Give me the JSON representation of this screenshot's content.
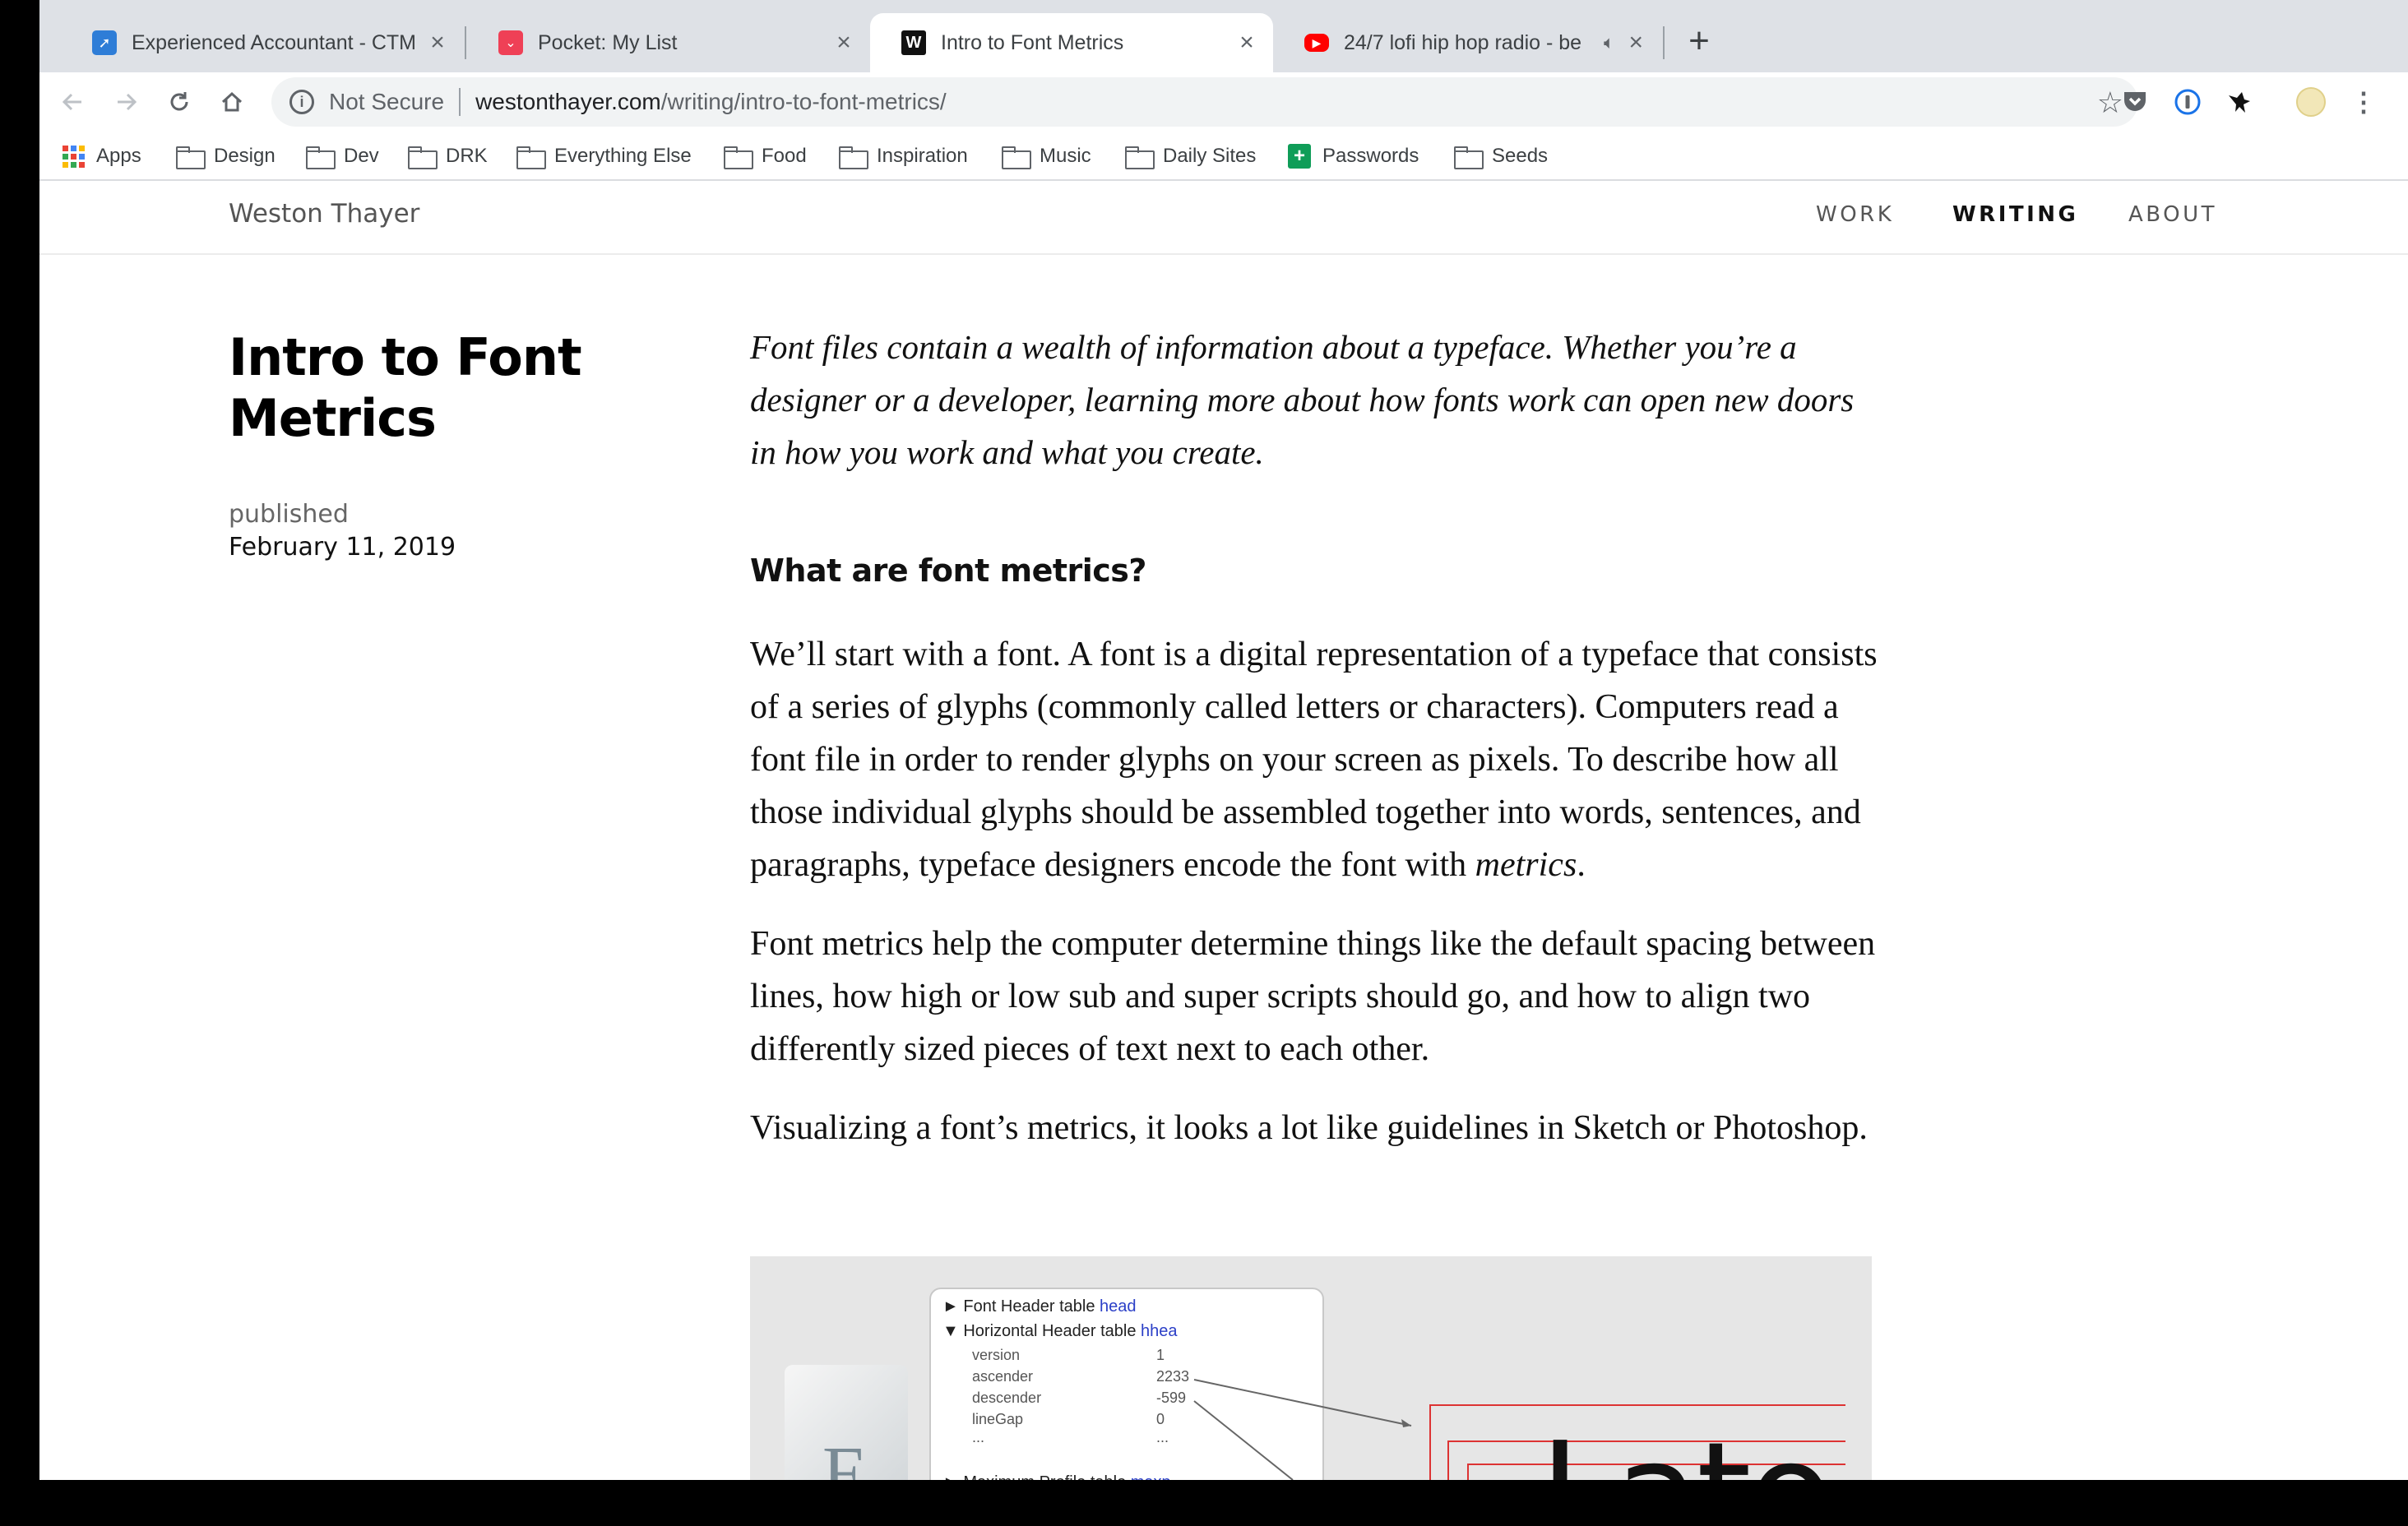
{
  "tabs": [
    {
      "title": "Experienced Accountant - CTM",
      "icon": "ctm-favicon",
      "color": "#2e7dd7"
    },
    {
      "title": "Pocket: My List",
      "icon": "pocket-favicon",
      "color": "#ef4056"
    },
    {
      "title": "Intro to Font Metrics",
      "icon": "w-favicon",
      "color": "#111111"
    },
    {
      "title": "24/7 lofi hip hop radio - be",
      "icon": "youtube-favicon",
      "color": "#ff0000"
    }
  ],
  "address": {
    "security": "Not Secure",
    "host": "westonthayer.com",
    "path": "/writing/intro-to-font-metrics/"
  },
  "bookmarks": [
    "Apps",
    "Design",
    "Dev",
    "DRK",
    "Everything Else",
    "Food",
    "Inspiration",
    "Music",
    "Daily Sites",
    "Passwords",
    "Seeds"
  ],
  "site": {
    "name": "Weston Thayer",
    "nav": [
      "WORK",
      "WRITING",
      "ABOUT"
    ],
    "active_nav": "WRITING"
  },
  "post": {
    "title": "Intro to Font Metrics",
    "published_label": "published",
    "date": "February 11, 2019",
    "lede": "Font files contain a wealth of information about a typeface. Whether you’re a designer or a developer, learning more about how fonts work can open new doors in how you work and what you create.",
    "heading": "What are font metrics?",
    "p1_before": "We’ll start with a font. A font is a digital representation of a typeface that consists of a series of glyphs (commonly called letters or characters). Computers read a font file in order to render glyphs on your screen as pixels. To describe how all those individual glyphs should be assembled together into words, sentences, and paragraphs, typeface designers encode the font with ",
    "p1_em": "metrics",
    "p1_after": ".",
    "p2": "Font metrics help the computer determine things like the default spacing between lines, how high or low sub and super scripts should go, and how to align two differently sized pieces of text next to each other.",
    "p3": "Visualizing a font’s metrics, it looks a lot like guidelines in Sketch or Photoshop."
  },
  "figure": {
    "rows": [
      {
        "label": "► Font Header table ",
        "tag": "head"
      },
      {
        "label": "▼ Horizontal Header table ",
        "tag": "hhea"
      }
    ],
    "fields": [
      {
        "k": "version",
        "v": "1"
      },
      {
        "k": "ascender",
        "v": "2233"
      },
      {
        "k": "descender",
        "v": "-599"
      },
      {
        "k": "lineGap",
        "v": "0"
      },
      {
        "k": "...",
        "v": "..."
      }
    ],
    "next_row": {
      "label": "► Maximum Profile table ",
      "tag": "maxp"
    },
    "file_glyph": "F",
    "sample": "Lato"
  },
  "colors": {
    "accent_red": "#dd3333",
    "link_blue": "#2b3fc7"
  }
}
